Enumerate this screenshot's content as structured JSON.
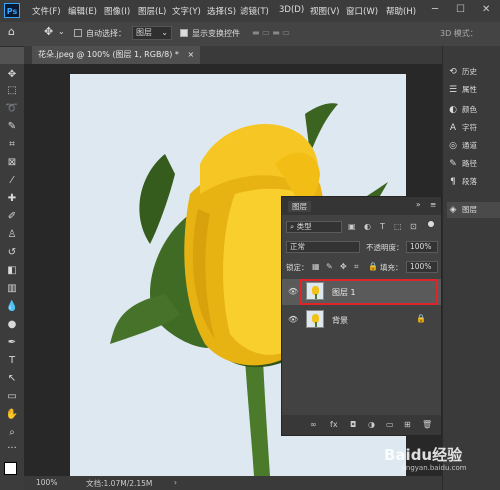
{
  "app": {
    "logo": "Ps"
  },
  "menu": [
    "文件(F)",
    "编辑(E)",
    "图像(I)",
    "图层(L)",
    "文字(Y)",
    "选择(S)",
    "滤镜(T)",
    "3D(D)",
    "视图(V)",
    "窗口(W)",
    "帮助(H)"
  ],
  "window_controls": [
    "─",
    "☐",
    "✕"
  ],
  "options": {
    "auto_select_label": "自动选择：",
    "auto_select_value": "图层",
    "transform_label": "显示变换控件",
    "mode_3d": "3D 模式：",
    "more": "..."
  },
  "tab": {
    "title": "花朵.jpeg @ 100% (图层 1, RGB/8) *",
    "close": "×"
  },
  "status": {
    "zoom": "100%",
    "doc": "文档:1.07M/2.15M"
  },
  "dock": {
    "items": [
      {
        "icon": "history-icon",
        "label": "历史"
      },
      {
        "icon": "properties-icon",
        "label": "属性"
      },
      {
        "icon": "color-icon",
        "label": "颜色"
      },
      {
        "icon": "character-icon",
        "label": "字符"
      },
      {
        "icon": "channels-icon",
        "label": "通道"
      },
      {
        "icon": "paths-icon",
        "label": "路径"
      },
      {
        "icon": "paragraph-icon",
        "label": "段落"
      },
      {
        "icon": "layers-icon",
        "label": "图层"
      }
    ]
  },
  "layers_panel": {
    "title": "图层",
    "filter_label": "类型",
    "blend_mode": "正常",
    "opacity_label": "不透明度：",
    "opacity_value": "100%",
    "lock_label": "锁定：",
    "fill_label": "填充：",
    "fill_value": "100%",
    "layers": [
      {
        "name": "图层 1",
        "selected": true
      },
      {
        "name": "背景",
        "selected": false,
        "locked": true
      }
    ],
    "footer_icons": [
      "link-icon",
      "fx-icon",
      "mask-icon",
      "adjustment-icon",
      "group-icon",
      "new-layer-icon",
      "delete-icon"
    ]
  },
  "watermark": {
    "text": "Baidu经验",
    "url": "jingyan.baidu.com"
  },
  "colors": {
    "accent": "#31a8ff",
    "highlight": "#e0242a",
    "petal": "#f2c11a"
  }
}
